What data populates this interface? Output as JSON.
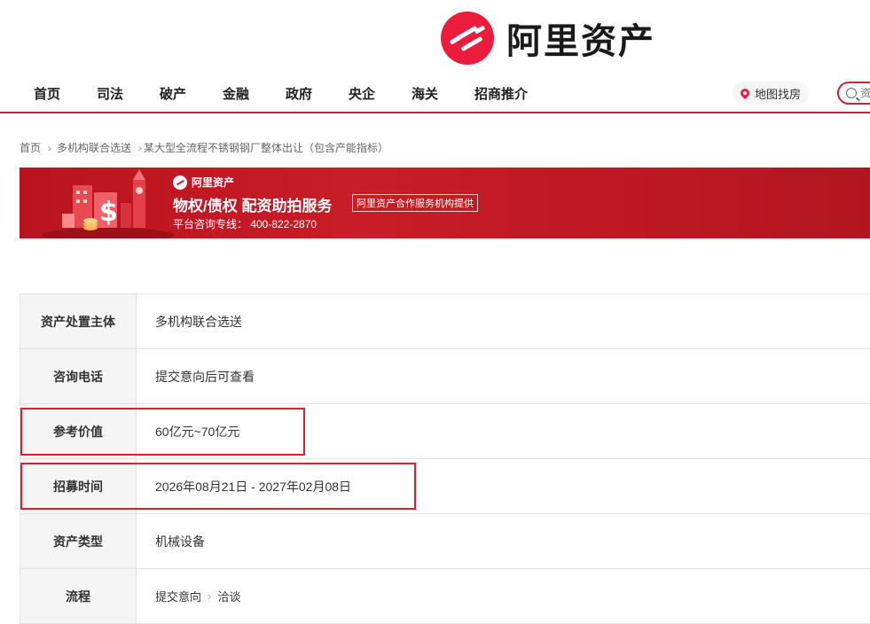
{
  "header": {
    "logo_text": "阿里资产",
    "brand_color": "#ec1c3c"
  },
  "nav": {
    "items": [
      "首页",
      "司法",
      "破产",
      "金融",
      "政府",
      "央企",
      "海关",
      "招商推介"
    ],
    "map_label": "地图找房",
    "search_placeholder": "资"
  },
  "breadcrumb": {
    "home": "首页",
    "category": "多机构联合选送",
    "current": "某大型全流程不锈钢钢厂整体出让（包含产能指标）"
  },
  "banner": {
    "logo_text": "阿里资产",
    "title": "物权/债权  配资助拍服务",
    "tag": "阿里资产合作服务机构提供",
    "phone": "平台咨询专线：  400-822-2870"
  },
  "details": {
    "rows": [
      {
        "label": "资产处置主体",
        "value": "多机构联合选送"
      },
      {
        "label": "咨询电话",
        "value": "提交意向后可查看"
      },
      {
        "label": "参考价值",
        "value": "60亿元~70亿元"
      },
      {
        "label": "招募时间",
        "value": "2026年08月21日 - 2027年02月08日"
      },
      {
        "label": "资产类型",
        "value": "机械设备"
      },
      {
        "label": "流程",
        "steps": [
          "提交意向",
          "洽谈"
        ]
      }
    ]
  },
  "annotation_color": "#e01d2a"
}
